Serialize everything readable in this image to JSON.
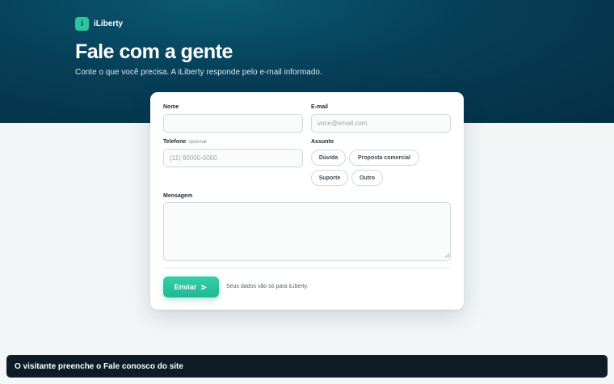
{
  "brand": {
    "logo_letter": "i",
    "name": "iLiberty"
  },
  "hero": {
    "title": "Fale com a gente",
    "subtitle": "Conte o que você precisa. A iLiberty responde pelo e-mail informado."
  },
  "form": {
    "name": {
      "label": "Nome",
      "value": "",
      "placeholder": ""
    },
    "email": {
      "label": "E-mail",
      "value": "",
      "placeholder": "voce@email.com"
    },
    "phone": {
      "label": "Telefone",
      "optional_label": "opcional",
      "value": "",
      "placeholder": "(11) 90000-0000"
    },
    "subject": {
      "label": "Assunto",
      "options": [
        "Dúvida",
        "Proposta comercial",
        "Suporte",
        "Outro"
      ]
    },
    "message": {
      "label": "Mensagem",
      "value": ""
    },
    "submit_label": "Enviar",
    "privacy_note": "Seus dados vão só para iLiberty."
  },
  "toast": {
    "text": "O visitante preenche o Fale conosco do site"
  },
  "colors": {
    "hero_bg": "#063f57",
    "accent": "#2ec4a0",
    "toast_bg": "#0f1c27"
  },
  "icons": {
    "submit": "send-arrow-icon",
    "textarea_resize": "resize-grip-icon"
  }
}
